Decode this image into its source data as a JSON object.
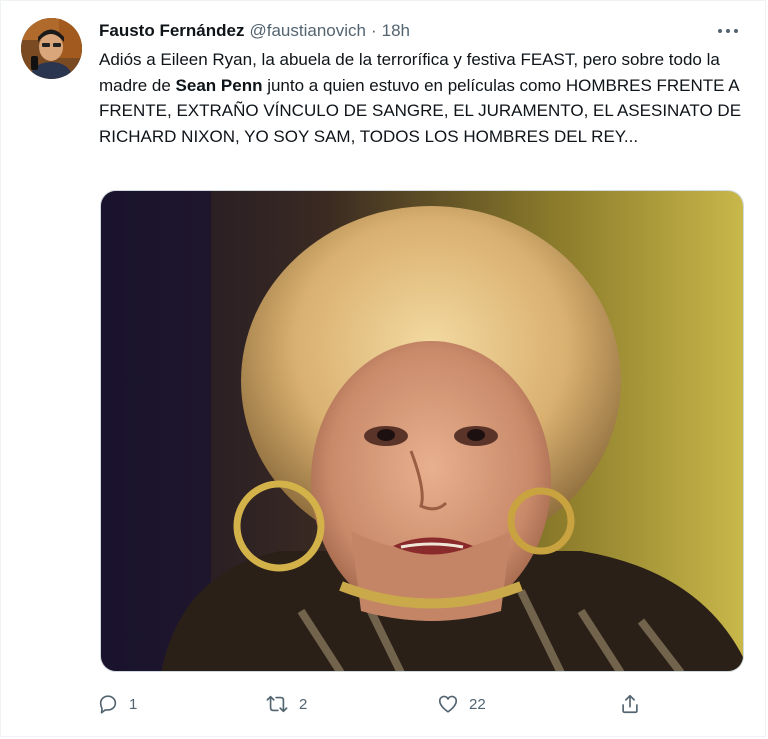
{
  "tweet": {
    "display_name": "Fausto Fernández",
    "handle": "@faustianovich",
    "separator": "·",
    "time": "18h",
    "text_part1": "Adiós a Eileen Ryan, la abuela de la terrorífica y festiva FEAST, pero sobre todo la madre de ",
    "text_bold": "Sean Penn",
    "text_part2": " junto a quien estuvo en películas como HOMBRES FRENTE A FRENTE, EXTRAÑO VÍNCULO DE SANGRE, EL JURAMENTO, EL ASESINATO DE RICHARD NIXON, YO SOY SAM, TODOS LOS HOMBRES DEL REY..."
  },
  "actions": {
    "reply_count": "1",
    "retweet_count": "2",
    "like_count": "22",
    "share_count": ""
  },
  "icons": {
    "more": "more-icon",
    "reply": "reply-icon",
    "retweet": "retweet-icon",
    "like": "heart-icon",
    "share": "share-icon"
  },
  "colors": {
    "text": "#0f1419",
    "secondary": "#536471",
    "border": "#cfd9de"
  }
}
